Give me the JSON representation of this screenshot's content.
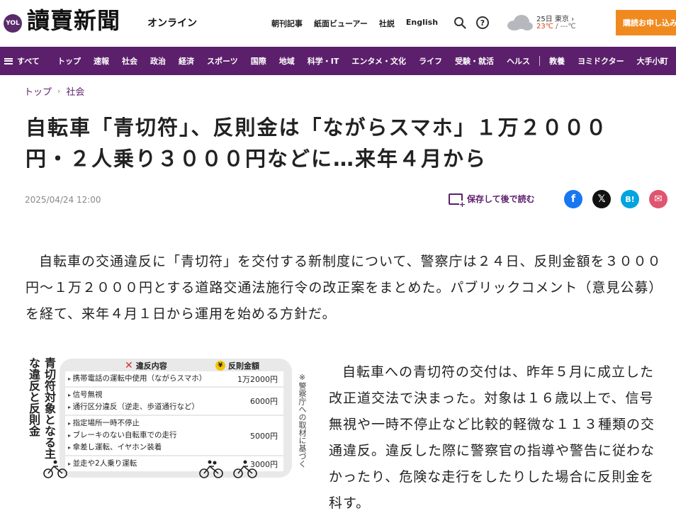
{
  "header": {
    "logo_badge": "YOL",
    "logo_text": "讀賣新聞",
    "logo_sub": "オンライン",
    "links": [
      "朝刊記事",
      "紙面ビューアー",
      "社説",
      "English"
    ],
    "weather": {
      "date_place": "25日 東京 ›",
      "temp_high": "23℃",
      "temp_sep": " / ",
      "temp_low": "---℃"
    },
    "subscribe_label": "購読お申し込み"
  },
  "nav": {
    "all_label": "すべて",
    "items": [
      "トップ",
      "速報",
      "社会",
      "政治",
      "経済",
      "スポーツ",
      "国際",
      "地域",
      "科学・IT",
      "エンタメ・文化",
      "ライフ",
      "受験・就活",
      "ヘルス"
    ],
    "items_after_sep": [
      "教養",
      "ヨミドクター",
      "大手小町"
    ]
  },
  "breadcrumb": {
    "top": "トップ",
    "section": "社会"
  },
  "article": {
    "title": "自転車「青切符」、反則金は「ながらスマホ」１万２０００円・２人乗り３０００円などに…来年４月から",
    "date": "2025/04/24 12:00",
    "save_later": "保存して後で読む",
    "lead": "自転車の交通違反に「青切符」を交付する新制度について、警察庁は２４日、反則金額を３０００円～１万２０００円とする道路交通法施行令の改正案をまとめた。パブリックコメント（意見公募）を経て、来年４月１日から運用を始める方針だ。",
    "para2": "自転車への青切符の交付は、昨年５月に成立した改正道交法で決まった。対象は１６歳以上で、信号無視や一時不停止など比較的軽微な１１３種類の交通違反。違反した際に警察官の指導や警告に従わなかったり、危険な走行をしたりした場合に反則金を科す。"
  },
  "share": {
    "fb": "f",
    "x": "𝕏",
    "hb": "B!",
    "mail": "✉"
  },
  "infographic": {
    "title": "青切符対象となる主な違反と反則金",
    "head_violation": "違反内容",
    "head_fine": "反則金額",
    "note": "※警察庁への取材に基づく",
    "rows": [
      {
        "items": [
          "携帯電話の運転中使用（ながらスマホ）"
        ],
        "amount": "1万2000円"
      },
      {
        "items": [
          "信号無視",
          "通行区分違反（逆走、歩道通行など）"
        ],
        "amount": "6000円"
      },
      {
        "items": [
          "指定場所一時不停止",
          "ブレーキのない自転車での走行",
          "傘差し運転、イヤホン装着"
        ],
        "amount": "5000円"
      },
      {
        "items": [
          "並走や2人乗り運転"
        ],
        "amount": "3000円"
      }
    ]
  }
}
